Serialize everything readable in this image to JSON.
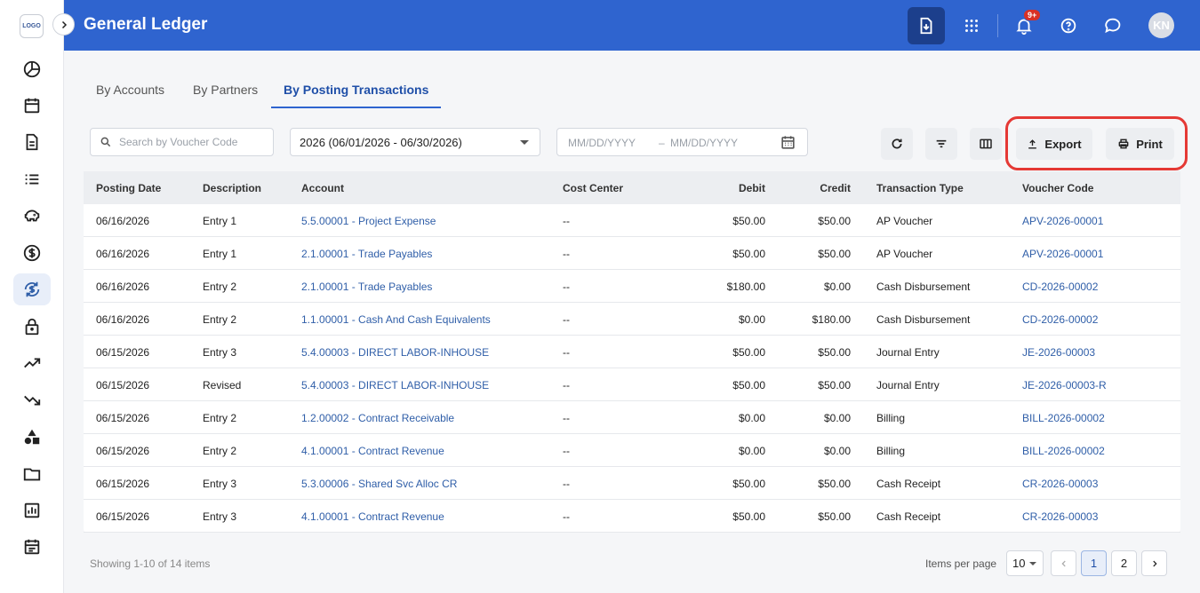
{
  "logo": "LOGO",
  "header": {
    "title": "General Ledger",
    "notif_count": "9+",
    "avatar_initials": "KN"
  },
  "tabs": [
    {
      "label": "By Accounts"
    },
    {
      "label": "By Partners"
    },
    {
      "label": "By Posting Transactions"
    }
  ],
  "toolbar": {
    "search_placeholder": "Search by Voucher Code",
    "period": "2026 (06/01/2026 - 06/30/2026)",
    "date_start_placeholder": "MM/DD/YYYY",
    "date_separator": "–",
    "date_end_placeholder": "MM/DD/YYYY",
    "export_label": "Export",
    "print_label": "Print"
  },
  "table": {
    "headers": [
      "Posting Date",
      "Description",
      "Account",
      "Cost Center",
      "Debit",
      "Credit",
      "Transaction Type",
      "Voucher Code"
    ],
    "rows": [
      [
        "06/16/2026",
        "Entry 1",
        "5.5.00001 - Project Expense",
        "--",
        "$50.00",
        "$50.00",
        "AP Voucher",
        "APV-2026-00001"
      ],
      [
        "06/16/2026",
        "Entry 1",
        "2.1.00001 - Trade Payables",
        "--",
        "$50.00",
        "$50.00",
        "AP Voucher",
        "APV-2026-00001"
      ],
      [
        "06/16/2026",
        "Entry 2",
        "2.1.00001 - Trade Payables",
        "--",
        "$180.00",
        "$0.00",
        "Cash Disbursement",
        "CD-2026-00002"
      ],
      [
        "06/16/2026",
        "Entry 2",
        "1.1.00001 - Cash And Cash Equivalents",
        "--",
        "$0.00",
        "$180.00",
        "Cash Disbursement",
        "CD-2026-00002"
      ],
      [
        "06/15/2026",
        "Entry 3",
        "5.4.00003 - DIRECT LABOR-INHOUSE",
        "--",
        "$50.00",
        "$50.00",
        "Journal Entry",
        "JE-2026-00003"
      ],
      [
        "06/15/2026",
        "Revised",
        "5.4.00003 - DIRECT LABOR-INHOUSE",
        "--",
        "$50.00",
        "$50.00",
        "Journal Entry",
        "JE-2026-00003-R"
      ],
      [
        "06/15/2026",
        "Entry 2",
        "1.2.00002 - Contract Receivable",
        "--",
        "$0.00",
        "$0.00",
        "Billing",
        "BILL-2026-00002"
      ],
      [
        "06/15/2026",
        "Entry 2",
        "4.1.00001 - Contract Revenue",
        "--",
        "$0.00",
        "$0.00",
        "Billing",
        "BILL-2026-00002"
      ],
      [
        "06/15/2026",
        "Entry 3",
        "5.3.00006 - Shared Svc Alloc CR",
        "--",
        "$50.00",
        "$50.00",
        "Cash Receipt",
        "CR-2026-00003"
      ],
      [
        "06/15/2026",
        "Entry 3",
        "4.1.00001 - Contract Revenue",
        "--",
        "$50.00",
        "$50.00",
        "Cash Receipt",
        "CR-2026-00003"
      ]
    ]
  },
  "footer": {
    "showing": "Showing 1-10 of 14 items",
    "items_per_page_label": "Items per page",
    "items_per_page": "10",
    "pages": [
      "1",
      "2"
    ]
  },
  "icons": {
    "sidebar": [
      "pie-chart-icon",
      "calendar-icon",
      "document-icon",
      "list-icon",
      "piggy-bank-icon",
      "dollar-icon",
      "currency-exchange-icon",
      "lock-icon",
      "trending-up-icon",
      "trending-down-icon",
      "shapes-icon",
      "folder-icon",
      "bar-chart-icon",
      "calendar-list-icon"
    ]
  },
  "colors": {
    "header": "#2f64cf",
    "header_dark_btn": "#1c3f8c",
    "link": "#2f5ea8",
    "highlight": "#e53935"
  }
}
